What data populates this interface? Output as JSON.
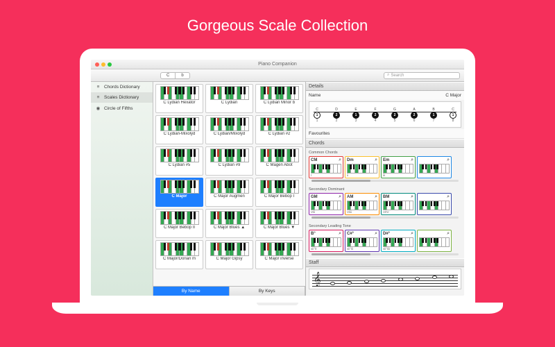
{
  "marketing_title": "Gorgeous Scale Collection",
  "window": {
    "title": "Piano Companion"
  },
  "toolbar": {
    "note": "C",
    "accidental": "b",
    "search_placeholder": "Search"
  },
  "sidebar": {
    "items": [
      {
        "label": "Chords Dictionary",
        "icon": "≡",
        "selected": false
      },
      {
        "label": "Scales Dictionary",
        "icon": "≡",
        "selected": true
      },
      {
        "label": "Circle of Fifths",
        "icon": "◉",
        "selected": false
      }
    ]
  },
  "grid": {
    "rows": [
      [
        "",
        "",
        ""
      ],
      [
        "C Lydian Hexator",
        "C Lydian",
        "C Lydian Minor b"
      ],
      [
        "",
        "",
        ""
      ],
      [
        "C Lydian-Mixolyd",
        "C Lydian/Mixolyd",
        "C Lydian #2"
      ],
      [
        "",
        "",
        ""
      ],
      [
        "C Lydian #5",
        "C Lydian #9",
        "C Magen Abot"
      ],
      [
        "",
        "",
        ""
      ],
      [
        "C Major",
        "C Major Augmen",
        "C Major Bebop I"
      ],
      [
        "",
        "",
        ""
      ],
      [
        "C Major Bebop II",
        "C Major Blues ▲",
        "C Major Blues ▼"
      ],
      [
        "",
        "",
        ""
      ],
      [
        "C Major/Dorian m",
        "C Major Gipsy",
        "C Major inverse"
      ]
    ],
    "selected": "C Major",
    "footer": [
      "By Name",
      "By Keys"
    ],
    "footer_selected": "By Name"
  },
  "details": {
    "header": "Details",
    "name_label": "Name",
    "name_value": "C Major",
    "diagram": {
      "letters": [
        "C",
        "D",
        "E",
        "F",
        "G",
        "A",
        "B",
        "C"
      ],
      "intervals": [
        "2",
        "2",
        "1",
        "2",
        "2",
        "2",
        "1"
      ],
      "degrees": [
        "1",
        "2",
        "3",
        "4",
        "5",
        "6",
        "7",
        "8"
      ]
    },
    "fav_label": "Favourites",
    "chords_header": "Chords",
    "groups": [
      {
        "label": "Common Chords",
        "items": [
          {
            "name": "CM",
            "num": "I",
            "color": "#e53935"
          },
          {
            "name": "Dm",
            "num": "ii",
            "color": "#fbc02d"
          },
          {
            "name": "Em",
            "num": "iii",
            "color": "#43a047"
          },
          {
            "name": "",
            "num": "",
            "color": "#1e88e5"
          }
        ]
      },
      {
        "label": "Secondary Dominant",
        "items": [
          {
            "name": "GM",
            "num": "V/ii",
            "color": "#8e24aa"
          },
          {
            "name": "AM",
            "num": "V/iii",
            "color": "#fb8c00"
          },
          {
            "name": "BM",
            "num": "V/IV",
            "color": "#00897b"
          },
          {
            "name": "",
            "num": "",
            "color": "#3949ab"
          }
        ]
      },
      {
        "label": "Secondary Leading Tone",
        "items": [
          {
            "name": "B°",
            "num": "vii°/I",
            "color": "#d81b60"
          },
          {
            "name": "C#°",
            "num": "vii°/ii",
            "color": "#5e35b1"
          },
          {
            "name": "D#°",
            "num": "vii°/iii",
            "color": "#00acc1"
          },
          {
            "name": "",
            "num": "",
            "color": "#7cb342"
          }
        ]
      }
    ],
    "staff_header": "Staff"
  }
}
